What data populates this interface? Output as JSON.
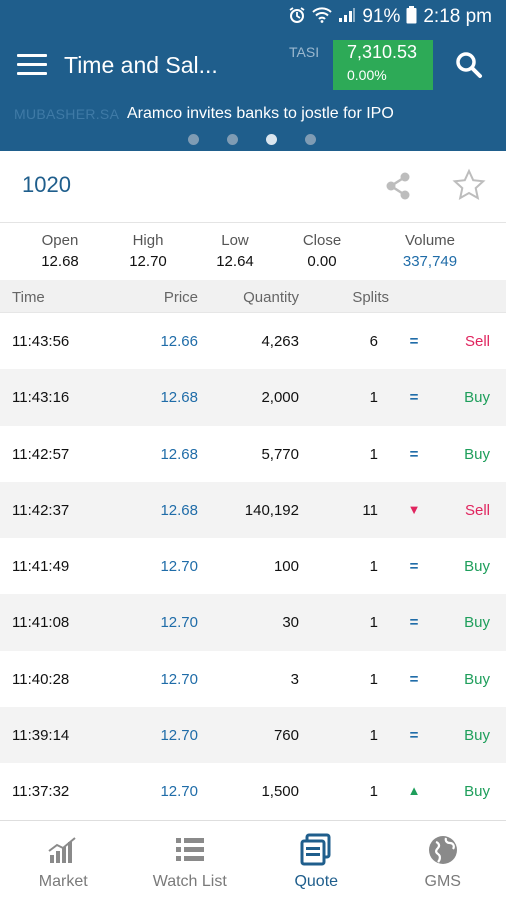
{
  "status_bar": {
    "battery": "91%",
    "time": "2:18 pm"
  },
  "header": {
    "title": "Time and Sal...",
    "index_name": "TASI",
    "index_value": "7,310.53",
    "index_change": "0.00%"
  },
  "ticker": {
    "source": "MUBASHER.SA",
    "headline": "Aramco invites banks to jostle for IPO",
    "page_count": 4,
    "active_page": 3
  },
  "symbol": "1020",
  "summary": {
    "open_label": "Open",
    "open": "12.68",
    "high_label": "High",
    "high": "12.70",
    "low_label": "Low",
    "low": "12.64",
    "close_label": "Close",
    "close": "0.00",
    "volume_label": "Volume",
    "volume": "337,749"
  },
  "table": {
    "headers": {
      "time": "Time",
      "price": "Price",
      "quantity": "Quantity",
      "splits": "Splits"
    },
    "rows": [
      {
        "time": "11:43:56",
        "price": "12.66",
        "quantity": "4,263",
        "splits": "6",
        "direction": "equal",
        "side": "Sell"
      },
      {
        "time": "11:43:16",
        "price": "12.68",
        "quantity": "2,000",
        "splits": "1",
        "direction": "equal",
        "side": "Buy"
      },
      {
        "time": "11:42:57",
        "price": "12.68",
        "quantity": "5,770",
        "splits": "1",
        "direction": "equal",
        "side": "Buy"
      },
      {
        "time": "11:42:37",
        "price": "12.68",
        "quantity": "140,192",
        "splits": "11",
        "direction": "down",
        "side": "Sell"
      },
      {
        "time": "11:41:49",
        "price": "12.70",
        "quantity": "100",
        "splits": "1",
        "direction": "equal",
        "side": "Buy"
      },
      {
        "time": "11:41:08",
        "price": "12.70",
        "quantity": "30",
        "splits": "1",
        "direction": "equal",
        "side": "Buy"
      },
      {
        "time": "11:40:28",
        "price": "12.70",
        "quantity": "3",
        "splits": "1",
        "direction": "equal",
        "side": "Buy"
      },
      {
        "time": "11:39:14",
        "price": "12.70",
        "quantity": "760",
        "splits": "1",
        "direction": "equal",
        "side": "Buy"
      },
      {
        "time": "11:37:32",
        "price": "12.70",
        "quantity": "1,500",
        "splits": "1",
        "direction": "up",
        "side": "Buy"
      }
    ]
  },
  "bottom_nav": [
    {
      "label": "Market",
      "icon": "bar-chart-icon",
      "active": false
    },
    {
      "label": "Watch List",
      "icon": "list-icon",
      "active": false
    },
    {
      "label": "Quote",
      "icon": "quote-icon",
      "active": true
    },
    {
      "label": "GMS",
      "icon": "globe-icon",
      "active": false
    }
  ],
  "colors": {
    "primary": "#1f5e8c",
    "index_green": "#2daa57",
    "buy": "#1e9e5b",
    "sell": "#e0245e",
    "price_blue": "#1f6ca8"
  }
}
